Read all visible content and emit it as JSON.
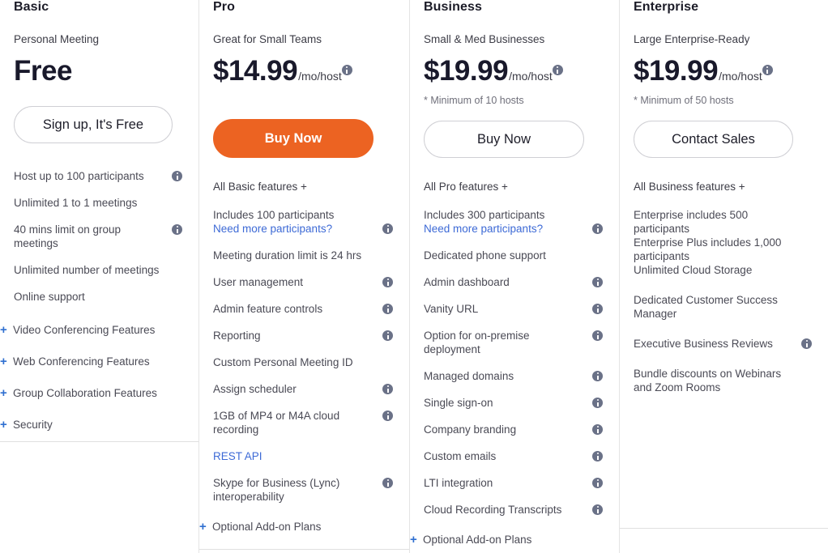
{
  "colors": {
    "primary_cta": "#ec6322",
    "link": "#3d6ad6",
    "plus": "#2f6fd0",
    "info_icon": "#6a7187",
    "text": "#4a4a55",
    "heading": "#1c1c28"
  },
  "icons": {
    "info": "info-icon",
    "plus": "+"
  },
  "plans": {
    "basic": {
      "name": "Basic",
      "tagline": "Personal Meeting",
      "price": "Free",
      "cta": "Sign up, It's Free",
      "features": [
        "Host up to 100 participants",
        "Unlimited 1 to 1 meetings",
        "40 mins limit on group meetings",
        "Unlimited number of meetings",
        "Online support"
      ],
      "expanders": [
        "Video Conferencing Features",
        "Web Conferencing Features",
        "Group Collaboration Features",
        "Security"
      ]
    },
    "pro": {
      "name": "Pro",
      "tagline": "Great for Small Teams",
      "price": "$14.99",
      "price_unit": "/mo/host",
      "cta": "Buy Now",
      "includes_head": "All Basic features +",
      "f0_text": "Includes 100 participants",
      "f0_link": "Need more participants?",
      "features": [
        "Meeting duration limit is 24 hrs",
        "User management",
        "Admin feature controls",
        "Reporting",
        "Custom Personal Meeting ID",
        "Assign scheduler",
        "1GB of MP4 or M4A cloud recording"
      ],
      "rest_api": "REST API",
      "skype": "Skype for Business (Lync) interoperability",
      "addon": "Optional Add-on Plans"
    },
    "business": {
      "name": "Business",
      "tagline": "Small & Med Businesses",
      "price": "$19.99",
      "price_unit": "/mo/host",
      "price_note": "* Minimum of 10 hosts",
      "cta": "Buy Now",
      "includes_head": "All Pro features +",
      "f0_text": "Includes 300 participants",
      "f0_link": "Need more participants?",
      "features": [
        "Dedicated phone support",
        "Admin dashboard",
        "Vanity URL",
        "Option for on-premise deployment",
        "Managed domains",
        "Single sign-on",
        "Company branding",
        "Custom emails",
        "LTI integration",
        "Cloud Recording Transcripts"
      ],
      "addon": "Optional Add-on Plans"
    },
    "enterprise": {
      "name": "Enterprise",
      "tagline": "Large Enterprise-Ready",
      "price": "$19.99",
      "price_unit": "/mo/host",
      "price_note": "* Minimum of 50 hosts",
      "cta": "Contact Sales",
      "includes_head": "All Business features +",
      "f0_a": "Enterprise includes 500 participants",
      "f0_b": "Enterprise Plus includes 1,000 participants",
      "f0_c": "Unlimited Cloud Storage",
      "features": [
        "Dedicated Customer Success Manager",
        "Executive Business Reviews",
        "Bundle discounts on Webinars and Zoom Rooms"
      ]
    }
  }
}
